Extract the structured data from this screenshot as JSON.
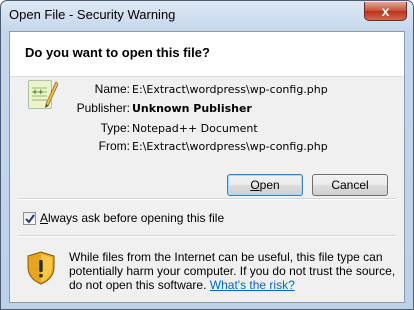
{
  "window": {
    "title": "Open File - Security Warning",
    "close_glyph": "x"
  },
  "dialog": {
    "question": "Do you want to open this file?",
    "file_icon": "notepad-plus-plus-document-icon",
    "fields": {
      "name_label": "Name:",
      "name_value": "E:\\Extract\\wordpress\\wp-config.php",
      "publisher_label": "Publisher:",
      "publisher_value": "Unknown Publisher",
      "type_label": "Type:",
      "type_value": "Notepad++ Document",
      "from_label": "From:",
      "from_value": "E:\\Extract\\wordpress\\wp-config.php"
    },
    "buttons": {
      "open_label_underlined": "O",
      "open_label_rest": "pen",
      "cancel_label": "Cancel"
    },
    "always_ask": {
      "checked": true,
      "label_underlined": "A",
      "label_rest": "lways ask before opening this file"
    },
    "warning": {
      "icon": "shield-warning-icon",
      "text": "While files from the Internet can be useful, this file type can potentially harm your computer. If you do not trust the source, do not open this software.",
      "link": "What's the risk?"
    }
  },
  "colors": {
    "link": "#0066cc",
    "title_bar": "#c5d7ec",
    "dialog_bg": "#f0f0f0",
    "close_button": "#c7503a"
  }
}
